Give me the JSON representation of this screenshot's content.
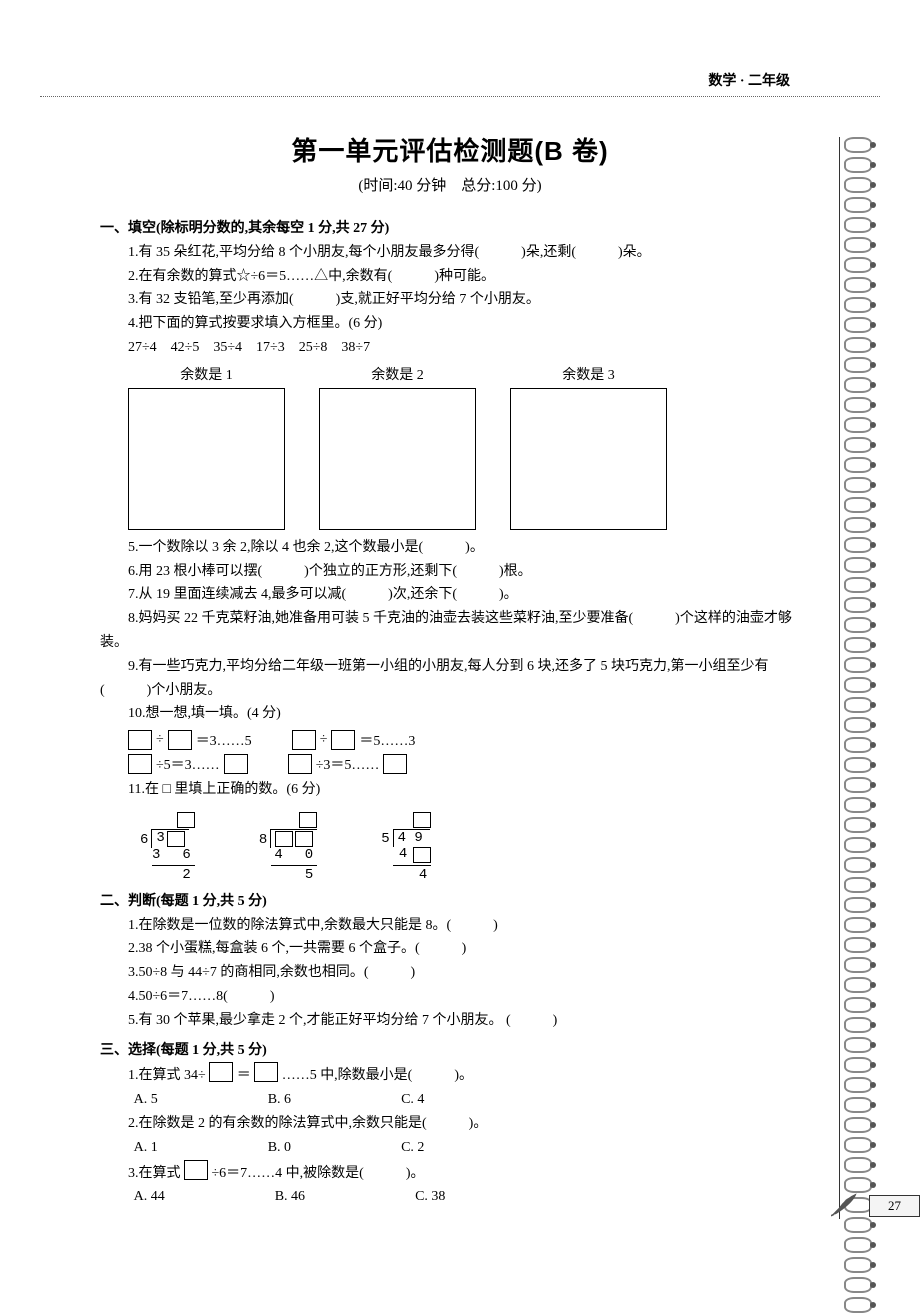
{
  "header": {
    "subject": "数学 · 二年级"
  },
  "title": "第一单元评估检测题(B 卷)",
  "subtitle": "(时间:40 分钟　总分:100 分)",
  "section1": {
    "heading": "一、填空(除标明分数的,其余每空 1 分,共 27 分)",
    "q1": "1.有 35 朵红花,平均分给 8 个小朋友,每个小朋友最多分得(　　　)朵,还剩(　　　)朵。",
    "q2": "2.在有余数的算式☆÷6＝5……△中,余数有(　　　)种可能。",
    "q3": "3.有 32 支铅笔,至少再添加(　　　)支,就正好平均分给 7 个小朋友。",
    "q4": "4.把下面的算式按要求填入方框里。(6 分)",
    "q4_expr": "27÷4　42÷5　35÷4　17÷3　25÷8　38÷7",
    "q4_labels": {
      "a": "余数是 1",
      "b": "余数是 2",
      "c": "余数是 3"
    },
    "q5": "5.一个数除以 3 余 2,除以 4 也余 2,这个数最小是(　　　)。",
    "q6": "6.用 23 根小棒可以摆(　　　)个独立的正方形,还剩下(　　　)根。",
    "q7": "7.从 19 里面连续减去 4,最多可以减(　　　)次,还余下(　　　)。",
    "q8": "8.妈妈买 22 千克菜籽油,她准备用可装 5 千克油的油壶去装这些菜籽油,至少要准备(　　　)个这样的油壶才够装。",
    "q9": "9.有一些巧克力,平均分给二年级一班第一小组的小朋友,每人分到 6 块,还多了 5 块巧克力,第一小组至少有(　　　)个小朋友。",
    "q10": "10.想一想,填一填。(4 分)",
    "q10_eq": {
      "a_suffix": "＝3……5",
      "b_suffix": "＝5……3",
      "c_mid": "÷5＝3……",
      "d_mid": "÷3＝5……"
    },
    "q11": "11.在 □ 里填上正确的数。(6 分)",
    "longdiv": {
      "d1": {
        "divisor": "6",
        "dividend_tens": "3",
        "sub": "3　6",
        "rem": "2"
      },
      "d2": {
        "divisor": "8",
        "sub": "4　0",
        "rem": "5"
      },
      "d3": {
        "divisor": "5",
        "dividend": "4 9",
        "sub_tens": "4",
        "rem": "4"
      }
    }
  },
  "section2": {
    "heading": "二、判断(每题 1 分,共 5 分)",
    "q1": "1.在除数是一位数的除法算式中,余数最大只能是 8。(　　　)",
    "q2": "2.38 个小蛋糕,每盒装 6 个,一共需要 6 个盒子。(　　　)",
    "q3": "3.50÷8 与 44÷7 的商相同,余数也相同。(　　　)",
    "q4": "4.50÷6＝7……8(　　　)",
    "q5": "5.有 30 个苹果,最少拿走 2 个,才能正好平均分给 7 个小朋友。  (　　　)"
  },
  "section3": {
    "heading": "三、选择(每题 1 分,共 5 分)",
    "q1_pre": "1.在算式 34÷",
    "q1_mid": "＝",
    "q1_post": "……5 中,除数最小是(　　　)。",
    "q1_choices": {
      "a": "A. 5",
      "b": "B. 6",
      "c": "C. 4"
    },
    "q2": "2.在除数是 2 的有余数的除法算式中,余数只能是(　　　)。",
    "q2_choices": {
      "a": "A. 1",
      "b": "B. 0",
      "c": "C. 2"
    },
    "q3_pre": "3.在算式",
    "q3_post": "÷6＝7……4 中,被除数是(　　　)。",
    "q3_choices": {
      "a": "A. 44",
      "b": "B. 46",
      "c": "C. 38"
    }
  },
  "page_number": "27"
}
